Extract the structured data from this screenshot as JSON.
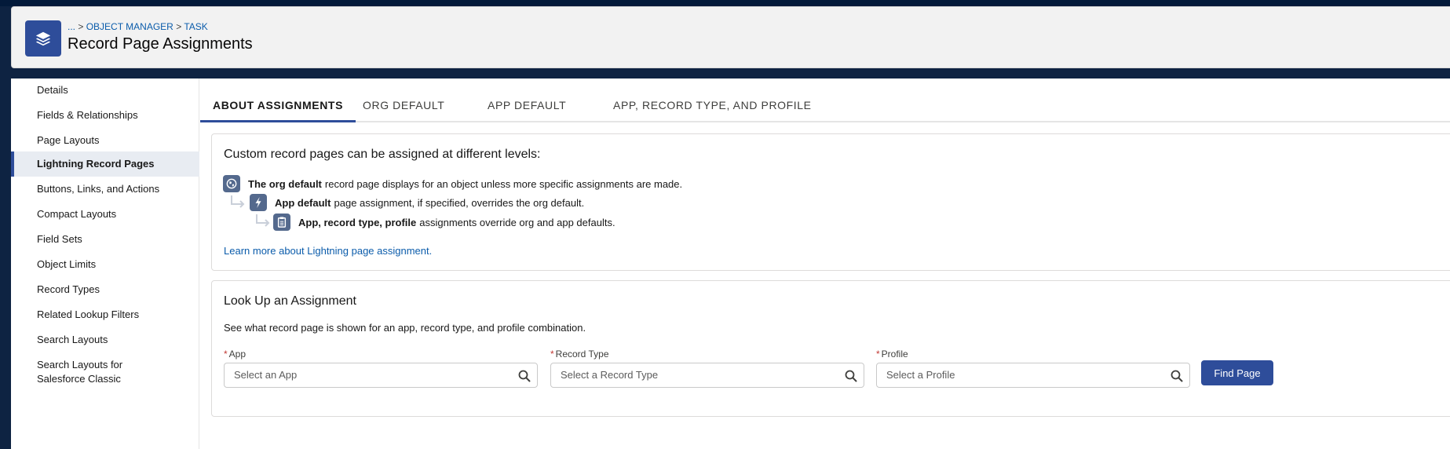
{
  "header": {
    "icon": "layers-icon",
    "breadcrumb": [
      {
        "label": "..."
      },
      {
        "label": "OBJECT MANAGER"
      },
      {
        "label": "TASK"
      }
    ],
    "breadcrumb_separator": ">",
    "title": "Record Page Assignments"
  },
  "sidebar": {
    "items": [
      {
        "label": "Details"
      },
      {
        "label": "Fields & Relationships"
      },
      {
        "label": "Page Layouts"
      },
      {
        "label": "Lightning Record Pages",
        "active": true
      },
      {
        "label": "Buttons, Links, and Actions"
      },
      {
        "label": "Compact Layouts"
      },
      {
        "label": "Field Sets"
      },
      {
        "label": "Object Limits"
      },
      {
        "label": "Record Types"
      },
      {
        "label": "Related Lookup Filters"
      },
      {
        "label": "Search Layouts"
      },
      {
        "label": "Search Layouts for Salesforce Classic"
      }
    ]
  },
  "tabs": [
    {
      "label": "ABOUT ASSIGNMENTS",
      "active": true
    },
    {
      "label": "ORG DEFAULT"
    },
    {
      "label": "APP DEFAULT"
    },
    {
      "label": "APP, RECORD TYPE, AND PROFILE"
    }
  ],
  "about_card": {
    "title": "Custom record pages can be assigned at different levels:",
    "levels": [
      {
        "icon": "globe-icon",
        "bold": "The org default",
        "text": "record page displays for an object unless more specific assignments are made."
      },
      {
        "icon": "lightning-bolt-icon",
        "bold": "App default",
        "text": "page assignment, if specified, overrides the org default."
      },
      {
        "icon": "clipboard-icon",
        "bold": "App, record type, profile",
        "text": "assignments override org and app defaults."
      }
    ],
    "learn_more": "Learn more about Lightning page assignment."
  },
  "lookup_card": {
    "title": "Look Up an Assignment",
    "subtitle": "See what record page is shown for an app, record type, and profile combination.",
    "required_marker": "*",
    "fields": [
      {
        "label": "App",
        "placeholder": "Select an App",
        "value": ""
      },
      {
        "label": "Record Type",
        "placeholder": "Select a Record Type",
        "value": ""
      },
      {
        "label": "Profile",
        "placeholder": "Select a Profile",
        "value": ""
      }
    ],
    "button": "Find Page"
  },
  "colors": {
    "brand": "#2e4d9a",
    "nav_background": "#0e2342",
    "link": "#0b5cab",
    "level_icon": "#54698d",
    "required": "#c23934"
  }
}
